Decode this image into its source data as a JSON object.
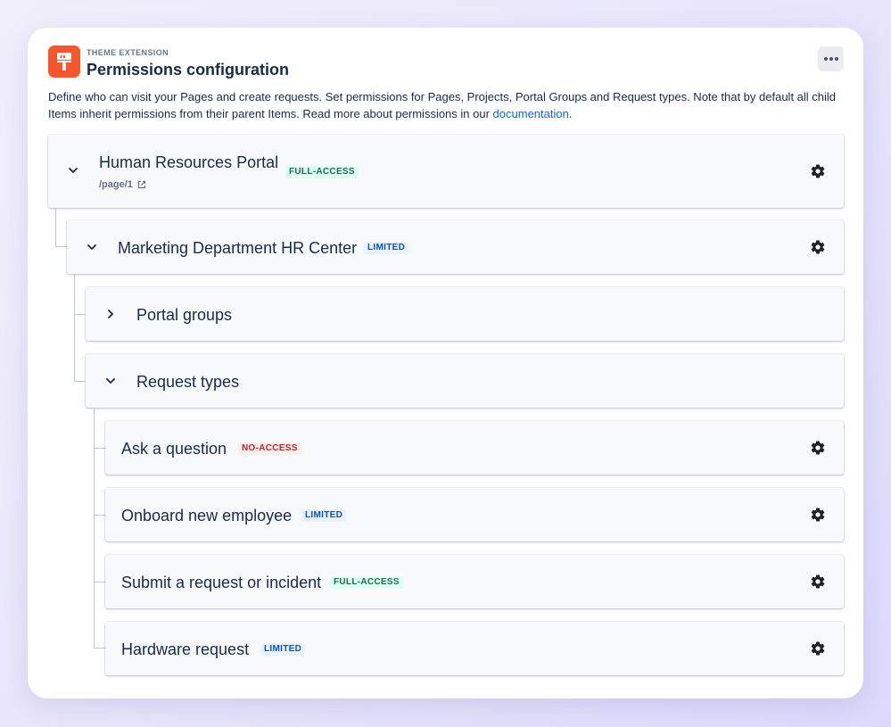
{
  "header": {
    "eyebrow": "THEME EXTENSION",
    "title": "Permissions configuration",
    "accent_color": "#f4572b"
  },
  "description": {
    "text": "Define who can visit your Pages and create requests. Set permissions for Pages, Projects, Portal Groups and Request types. Note that by default all child Items inherit permissions from their parent Items. Read more about permissions in our ",
    "link": "documentation",
    "suffix": "."
  },
  "tree": {
    "portal": {
      "label": "Human Resources Portal",
      "badge": "FULL-ACCESS",
      "path": "/page/1"
    },
    "project": {
      "label": "Marketing Department HR Center",
      "badge": "LIMITED"
    },
    "portal_groups": {
      "label": "Portal groups"
    },
    "request_types": {
      "label": "Request types",
      "items": [
        {
          "label": "Ask a question",
          "badge": "NO-ACCESS"
        },
        {
          "label": "Onboard new employee",
          "badge": "LIMITED"
        },
        {
          "label": "Submit a request or incident",
          "badge": "FULL-ACCESS"
        },
        {
          "label": "Hardware request",
          "badge": "LIMITED"
        }
      ]
    }
  },
  "icons": {
    "app": "paint-roller-icon",
    "more": "more-horizontal-icon",
    "expand": "chevron-down-icon",
    "collapse": "chevron-right-icon",
    "settings": "gear-icon",
    "external": "external-link-icon"
  }
}
